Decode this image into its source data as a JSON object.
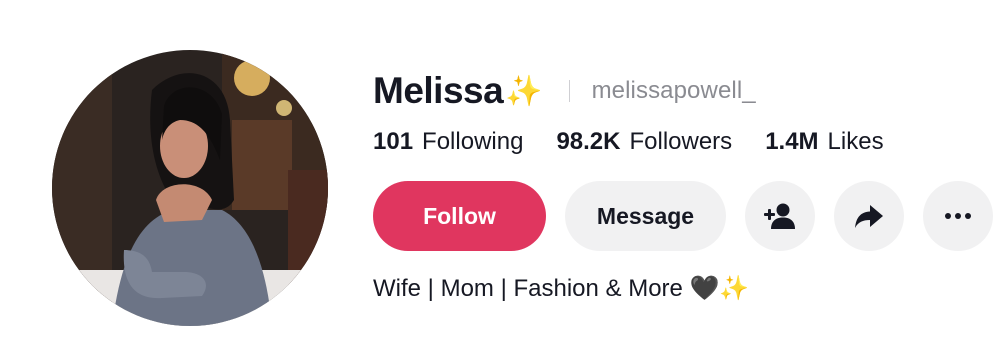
{
  "profile": {
    "display_name": "Melissa",
    "name_emoji": "✨",
    "username": "melissapowell_",
    "bio": "Wife | Mom | Fashion & More 🖤✨"
  },
  "stats": {
    "following": {
      "value": "101",
      "label": "Following"
    },
    "followers": {
      "value": "98.2K",
      "label": "Followers"
    },
    "likes": {
      "value": "1.4M",
      "label": "Likes"
    }
  },
  "actions": {
    "follow_label": "Follow",
    "message_label": "Message",
    "add_friend_icon": "add-user-icon",
    "share_icon": "share-icon",
    "more_icon": "more-horizontal-icon"
  },
  "colors": {
    "follow_button": "#e0365f",
    "secondary_button": "#f1f1f2",
    "username_text": "#8a8b91"
  }
}
